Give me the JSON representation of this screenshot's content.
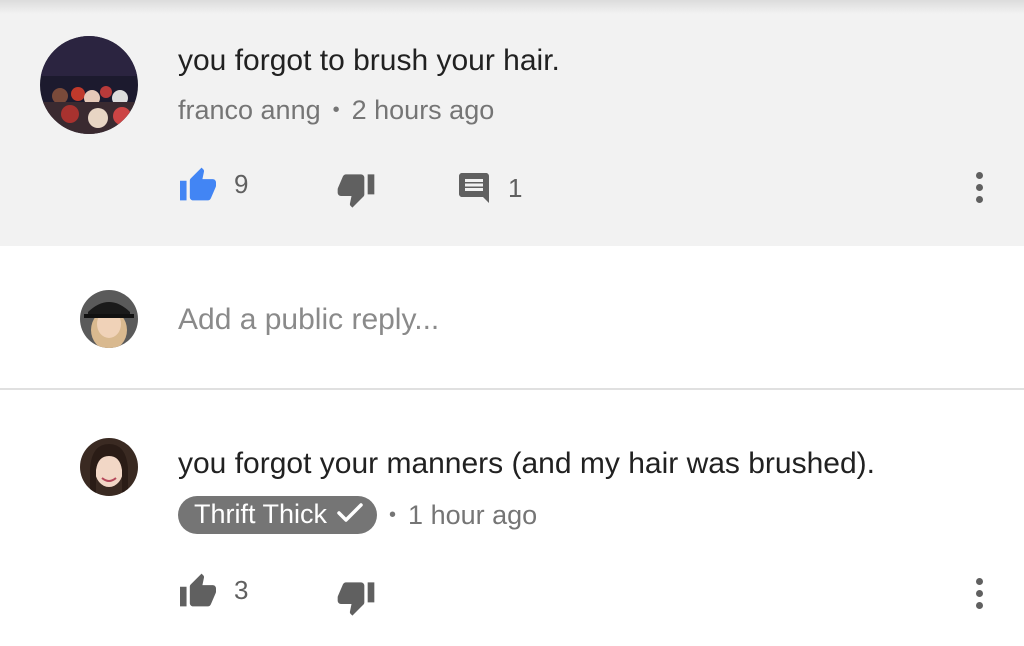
{
  "parent_comment": {
    "text": "you forgot to brush your hair.",
    "author": "franco anng",
    "separator": "•",
    "time": "2 hours ago",
    "like_count": "9",
    "reply_count": "1",
    "like_color": "#4285f4"
  },
  "reply_box": {
    "placeholder": "Add a public reply..."
  },
  "reply_comment": {
    "text": "you forgot your manners (and my hair was brushed).",
    "author": "Thrift Thick",
    "separator": "•",
    "time": "1 hour ago",
    "like_count": "3"
  },
  "icons": {
    "like": "thumbs-up-icon",
    "dislike": "thumbs-down-icon",
    "reply": "comment-icon",
    "more": "more-vertical-icon",
    "verified": "checkmark-icon"
  }
}
